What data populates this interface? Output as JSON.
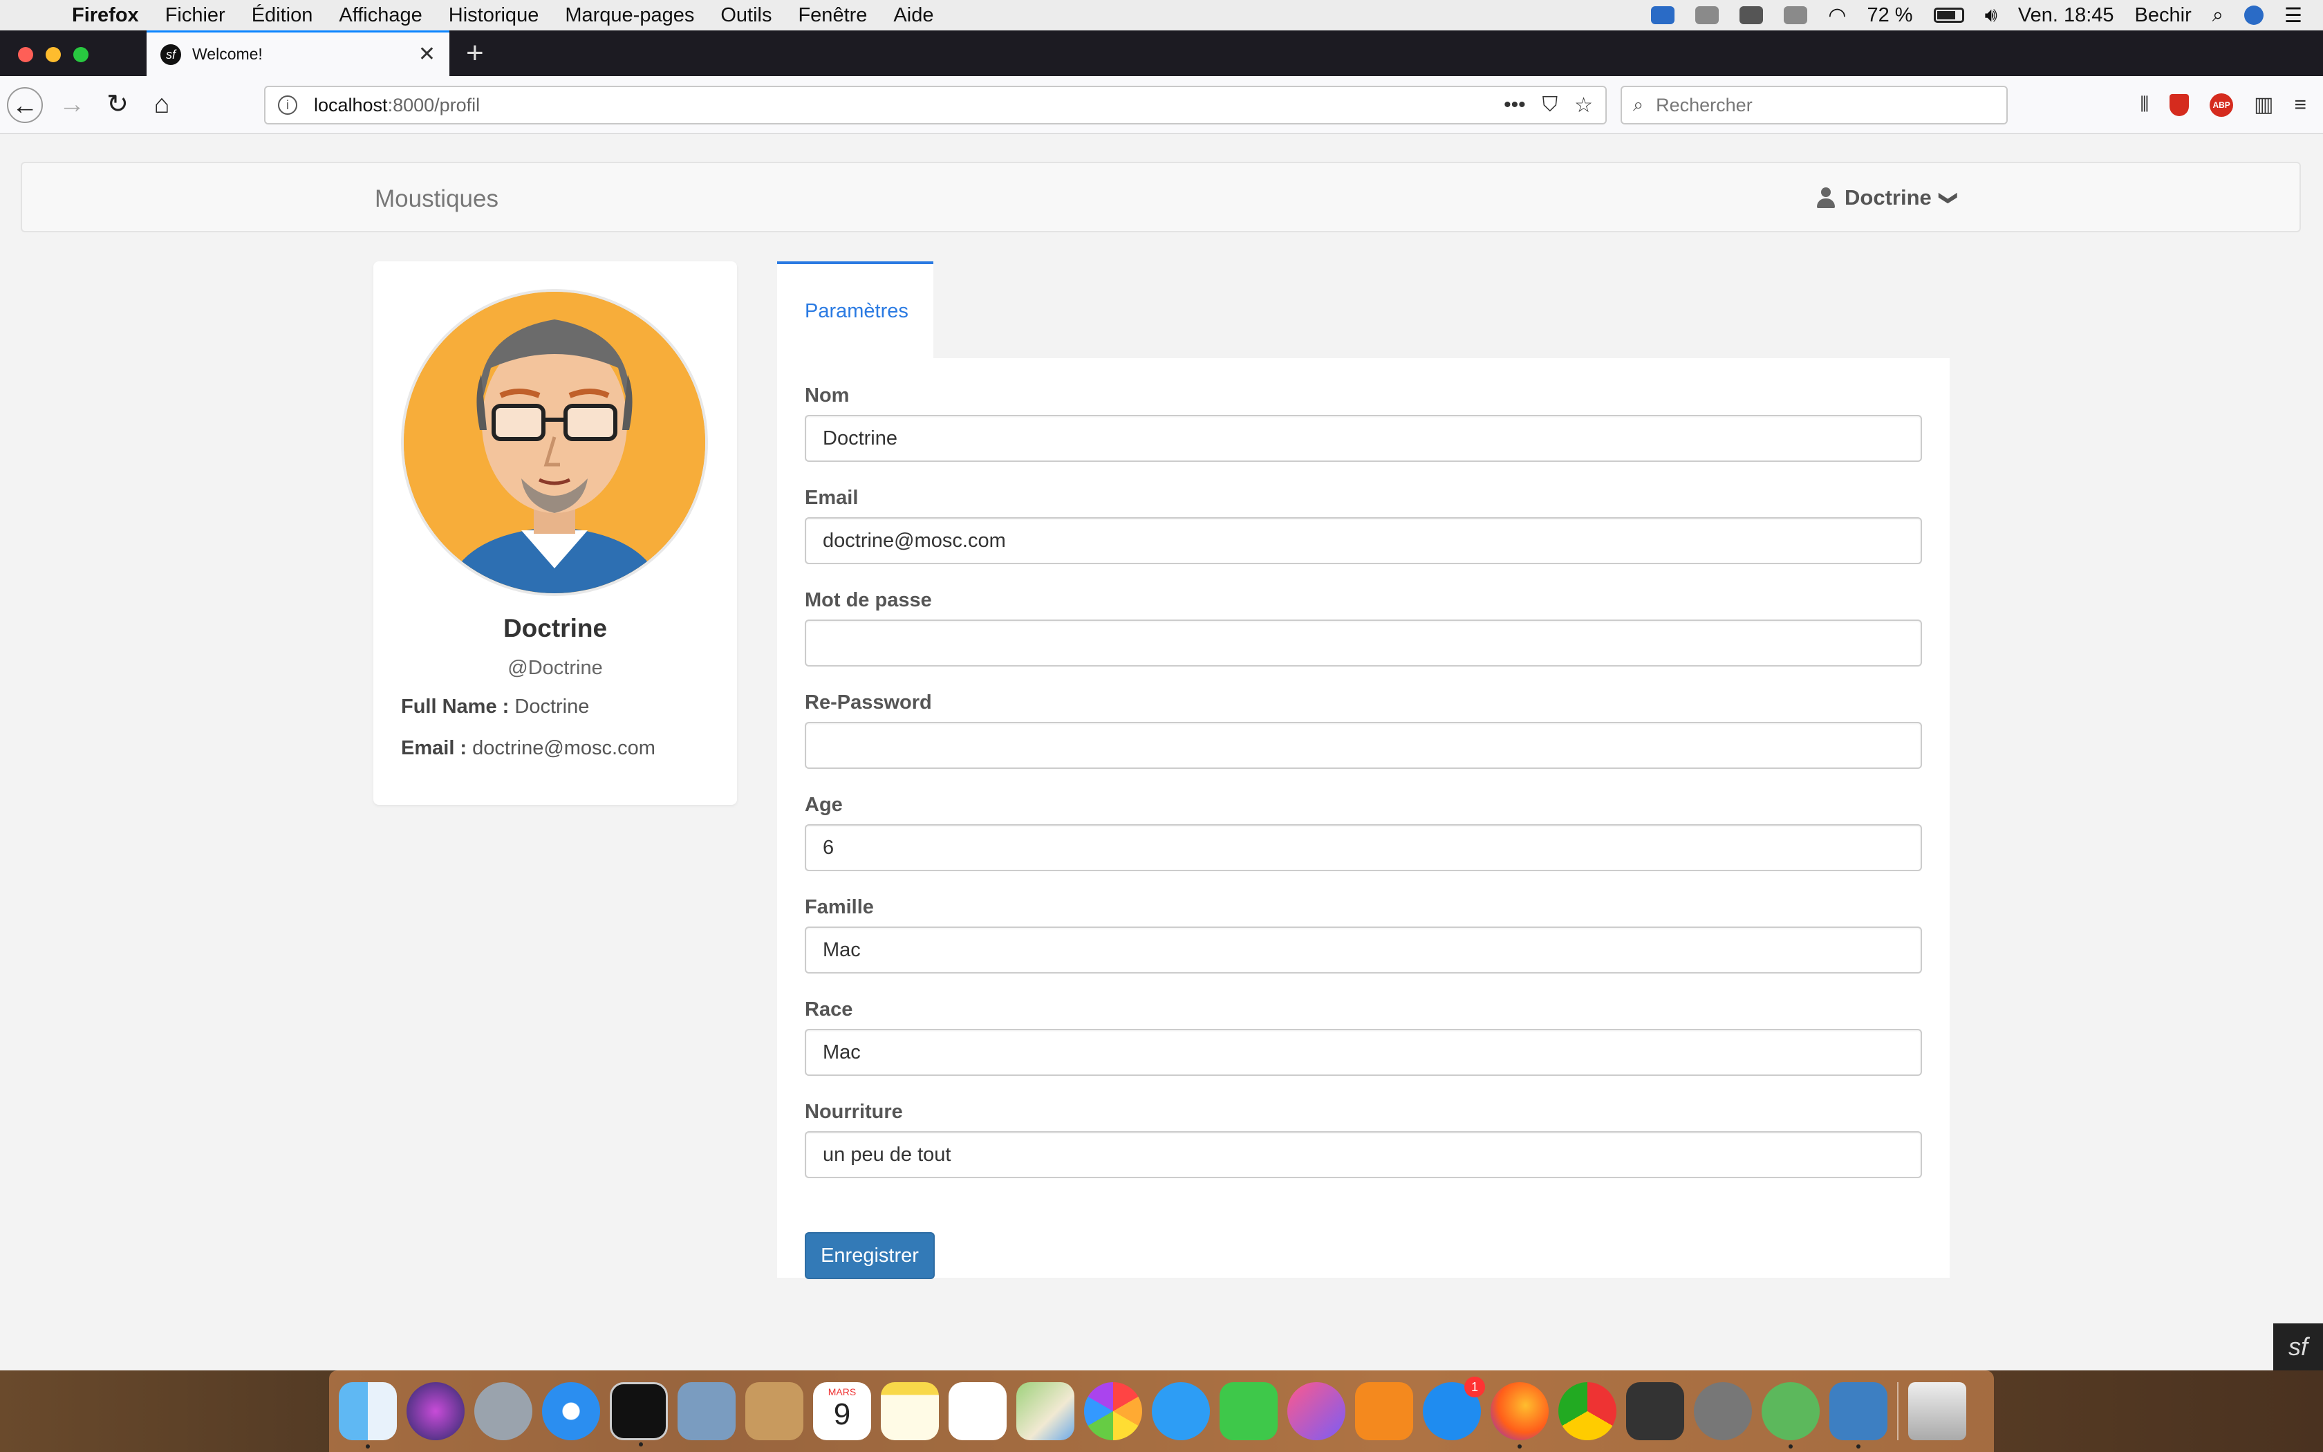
{
  "menubar": {
    "apple": "",
    "items": [
      "Firefox",
      "Fichier",
      "Édition",
      "Affichage",
      "Historique",
      "Marque-pages",
      "Outils",
      "Fenêtre",
      "Aide"
    ],
    "battery_percent": "72 %",
    "clock": "Ven. 18:45",
    "user": "Bechir"
  },
  "browser": {
    "tab_title": "Welcome!",
    "tab_favicon": "sf",
    "url_host": "localhost",
    "url_path": ":8000/profil",
    "search_placeholder": "Rechercher",
    "more_icon": "•••"
  },
  "site": {
    "brand": "Moustiques",
    "user_menu": "Doctrine",
    "user_caret": "❯"
  },
  "profile": {
    "name": "Doctrine",
    "handle": "@Doctrine",
    "full_name_label": "Full Name :",
    "full_name_value": "Doctrine",
    "email_label": "Email :",
    "email_value": "doctrine@mosc.com"
  },
  "settings": {
    "tab_label": "Paramètres",
    "fields": [
      {
        "label": "Nom",
        "value": "Doctrine"
      },
      {
        "label": "Email",
        "value": "doctrine@mosc.com"
      },
      {
        "label": "Mot de passe",
        "value": ""
      },
      {
        "label": "Re-Password",
        "value": ""
      },
      {
        "label": "Age",
        "value": "6"
      },
      {
        "label": "Famille",
        "value": "Mac"
      },
      {
        "label": "Race",
        "value": "Mac"
      },
      {
        "label": "Nourriture",
        "value": "un peu de tout"
      }
    ],
    "submit_label": "Enregistrer"
  },
  "dock": {
    "calendar_month": "MARS",
    "calendar_day": "9",
    "appstore_badge": "1"
  },
  "colors": {
    "accent": "#2a7ae2",
    "button": "#337ab7",
    "avatar_bg": "#f7ad3a"
  }
}
